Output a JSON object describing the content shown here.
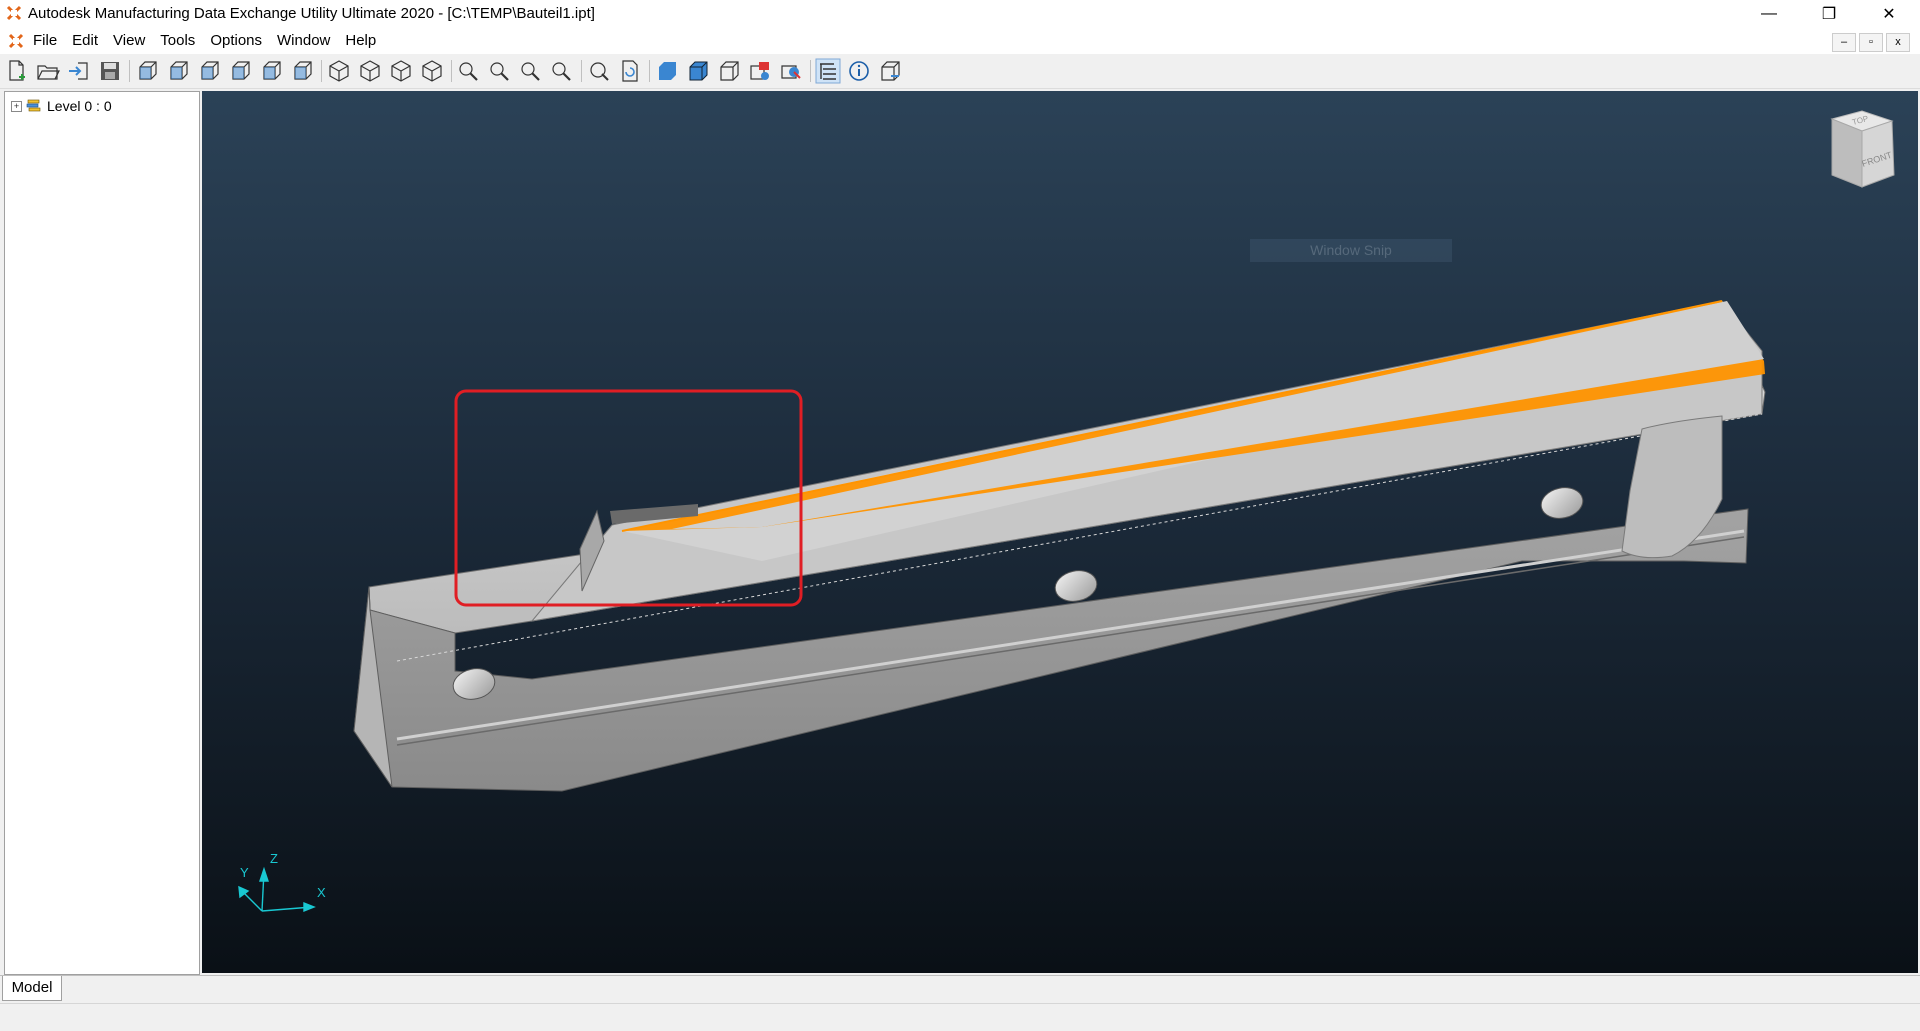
{
  "window": {
    "title": "Autodesk Manufacturing Data Exchange Utility Ultimate 2020 - [C:\\TEMP\\Bauteil1.ipt]",
    "minimize_label": "—",
    "restore_label": "❐",
    "close_label": "✕"
  },
  "menu": {
    "items": [
      {
        "label": "File"
      },
      {
        "label": "Edit"
      },
      {
        "label": "View"
      },
      {
        "label": "Tools"
      },
      {
        "label": "Options"
      },
      {
        "label": "Window"
      },
      {
        "label": "Help"
      }
    ]
  },
  "mdi": {
    "minimize": "–",
    "restore": "▫",
    "close": "x"
  },
  "toolbar": {
    "buttons": [
      "new-icon",
      "open-icon",
      "import-icon",
      "save-icon",
      "view-front-icon",
      "view-back-icon",
      "view-left-icon",
      "view-right-icon",
      "view-top-icon",
      "view-bottom-icon",
      "iso-view-1-icon",
      "iso-view-2-icon",
      "iso-view-3-icon",
      "iso-view-4-icon",
      "zoom-window-icon",
      "zoom-in-icon",
      "zoom-out-icon",
      "zoom-fit-icon",
      "rotate-icon",
      "refresh-icon",
      "shaded-icon",
      "shaded-edges-icon",
      "wireframe-icon",
      "section-icon",
      "render-icon",
      "tree-toggle-icon",
      "info-icon",
      "3d-box-icon"
    ]
  },
  "tree": {
    "items": [
      {
        "label": "Level 0 : 0",
        "expander": "+"
      }
    ]
  },
  "viewport": {
    "snip_label": "Window Snip",
    "viewcube": {
      "top": "TOP",
      "front": "FRONT"
    },
    "axes": {
      "x": "X",
      "y": "Y",
      "z": "Z"
    },
    "colors": {
      "highlight": "#ff9400",
      "annotation": "#e01e24",
      "axes": "#19c8d2"
    }
  },
  "tabs": {
    "model": "Model"
  }
}
